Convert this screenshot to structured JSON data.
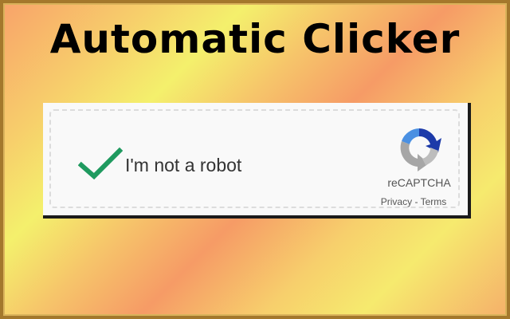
{
  "headline": "Automatic Clicker",
  "captcha": {
    "checkbox_label": "I'm not a robot",
    "checked": true,
    "brand": "reCAPTCHA",
    "privacy_link": "Privacy",
    "separator": " - ",
    "terms_link": "Terms",
    "icons": {
      "checkmark": "checkmark-icon",
      "logo": "recaptcha-logo-icon"
    }
  },
  "colors": {
    "checkmark": "#1f9a5f",
    "logo_blue": "#4a90e2",
    "logo_dark_blue": "#1c3aa9",
    "logo_gray": "#a6a6a6",
    "frame": "#a4782c"
  }
}
